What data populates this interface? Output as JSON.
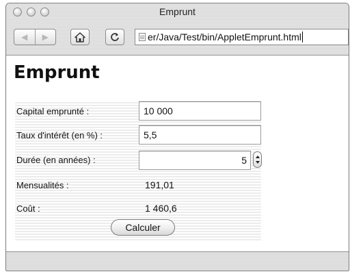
{
  "window": {
    "title": "Emprunt"
  },
  "toolbar": {
    "back_icon": "back-arrow-icon",
    "forward_icon": "forward-arrow-icon",
    "home_icon": "home-icon",
    "reload_icon": "reload-icon",
    "url": "er/Java/Test/bin/AppletEmprunt.html"
  },
  "page": {
    "heading": "Emprunt"
  },
  "form": {
    "capital_label": "Capital emprunté :",
    "capital_value": "10 000",
    "taux_label": "Taux d'intérêt (en %) :",
    "taux_value": "5,5",
    "duree_label": "Durée (en années) :",
    "duree_value": "5",
    "mensualites_label": "Mensualités :",
    "mensualites_value": "191,01",
    "cout_label": "Coût :",
    "cout_value": "1 460,6",
    "calculer_label": "Calculer"
  }
}
